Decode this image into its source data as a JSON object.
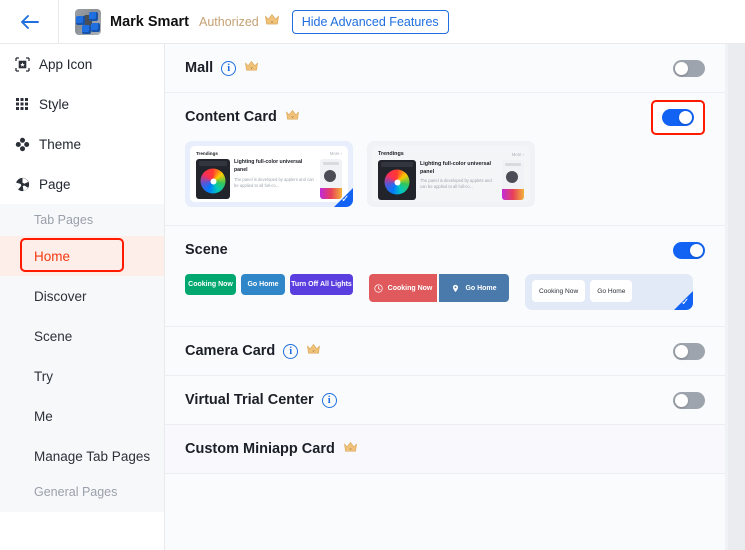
{
  "header": {
    "back_icon": "arrow-left-icon",
    "avatar_icon": "app-avatar-icon",
    "app_title": "Mark Smart",
    "auth_label": "Authorized",
    "crown_icon": "crown-icon",
    "advanced_button": "Hide Advanced Features"
  },
  "sidebar": {
    "items": [
      {
        "label": "App Icon",
        "icon": "app-icon-frame-icon"
      },
      {
        "label": "Style",
        "icon": "grid-dots-icon"
      },
      {
        "label": "Theme",
        "icon": "clover-icon"
      },
      {
        "label": "Page",
        "icon": "page-pinwheel-icon"
      }
    ],
    "sub_header": "Tab Pages",
    "sub_items": [
      {
        "label": "Home",
        "active": true
      },
      {
        "label": "Discover",
        "active": false
      },
      {
        "label": "Scene",
        "active": false
      },
      {
        "label": "Try",
        "active": false
      },
      {
        "label": "Me",
        "active": false
      },
      {
        "label": "Manage Tab Pages",
        "active": false
      }
    ],
    "general_header": "General Pages"
  },
  "sections": {
    "mall": {
      "title": "Mall",
      "has_info": true,
      "has_crown": true,
      "toggle_state": "off",
      "toggle_highlighted": false
    },
    "content_card": {
      "title": "Content Card",
      "has_info": false,
      "has_crown": true,
      "toggle_state": "on",
      "toggle_highlighted": true,
      "previews": [
        {
          "selected": true,
          "heading": "Trendings",
          "more": "More  ›",
          "item_title": "Lighting full-color universal panel",
          "item_desc": "The panel is developed by applers and can be applied to all full-co..."
        },
        {
          "selected": false,
          "heading": "Trendings",
          "more": "More  ›",
          "item_title": "Lighting full-color universal panel",
          "item_desc": "The panel is developed by applets and can be applied to all full-co..."
        }
      ]
    },
    "scene": {
      "title": "Scene",
      "has_info": false,
      "has_crown": false,
      "toggle_state": "on",
      "toggle_highlighted": false,
      "style1": [
        {
          "label": "Cooking Now",
          "color": "#00a870"
        },
        {
          "label": "Go Home",
          "color": "#2f86c8"
        },
        {
          "label": "Turn Off All Lights",
          "color": "#5b3ee0"
        }
      ],
      "style2": [
        {
          "label": "Cooking Now",
          "color": "#e0595c",
          "icon": "clock-icon"
        },
        {
          "label": "Go Home",
          "color": "#4a7aab",
          "icon": "location-pin-icon"
        }
      ],
      "style3": {
        "selected": true,
        "buttons": [
          {
            "label": "Cooking Now"
          },
          {
            "label": "Go Home"
          }
        ]
      }
    },
    "camera_card": {
      "title": "Camera Card",
      "has_info": true,
      "has_crown": true,
      "toggle_state": "off",
      "toggle_highlighted": false
    },
    "virtual_trial": {
      "title": "Virtual Trial Center",
      "has_info": true,
      "has_crown": false,
      "toggle_state": "off",
      "toggle_highlighted": false
    },
    "custom_miniapp": {
      "title": "Custom Miniapp Card",
      "has_info": false,
      "has_crown": true
    }
  },
  "colors": {
    "accent_blue": "#1263f3",
    "highlight_red": "#ff1a00",
    "gold": "#c4a173",
    "active_text": "#f5390f"
  }
}
